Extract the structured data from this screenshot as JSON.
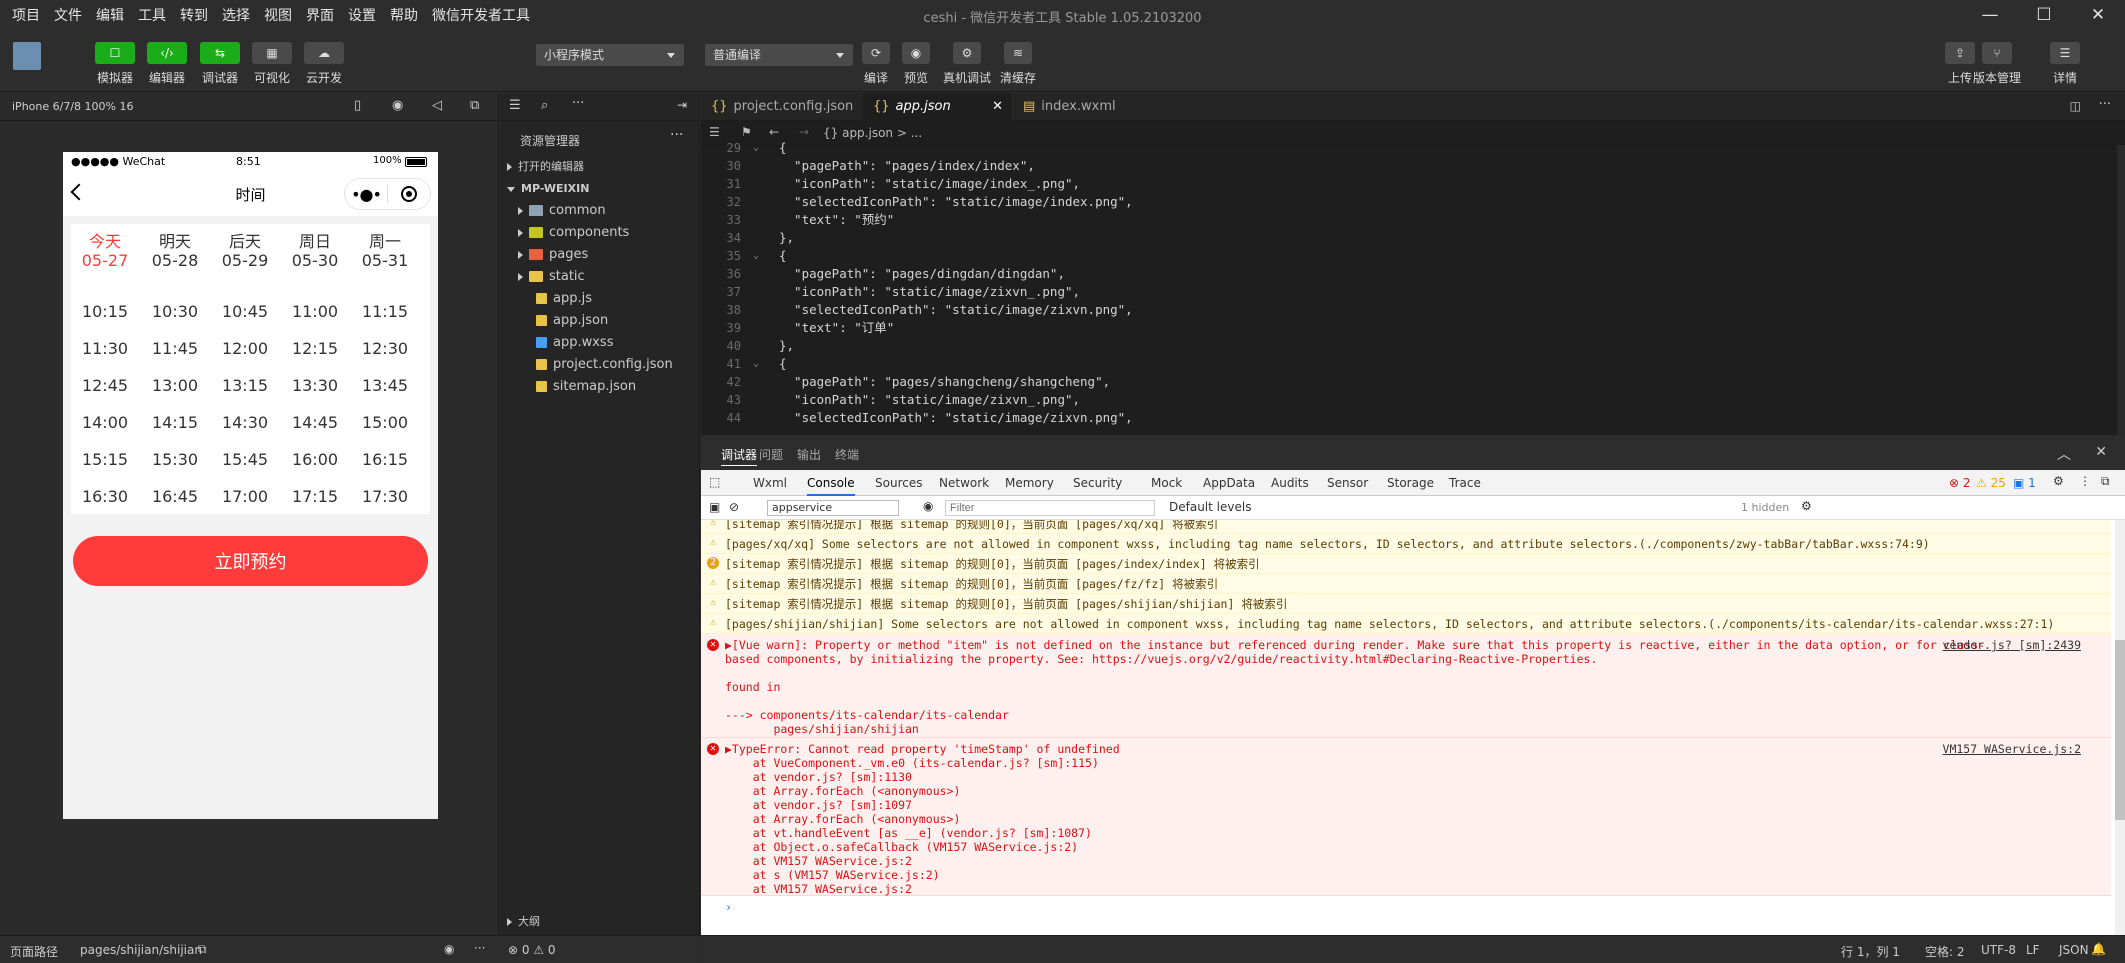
{
  "menubar": [
    "项目",
    "文件",
    "编辑",
    "工具",
    "转到",
    "选择",
    "视图",
    "界面",
    "设置",
    "帮助",
    "微信开发者工具"
  ],
  "window_title": "ceshi - 微信开发者工具 Stable 1.05.2103200",
  "toolbar": {
    "left_buttons": [
      {
        "label": "模拟器",
        "icon": "phone-icon"
      },
      {
        "label": "编辑器",
        "icon": "code-icon"
      },
      {
        "label": "调试器",
        "icon": "debug-icon"
      },
      {
        "label": "可视化",
        "icon": "grid-icon"
      },
      {
        "label": "云开发",
        "icon": "cloud-icon"
      }
    ],
    "mode_select": "小程序模式",
    "compile_select": "普通编译",
    "mid_buttons": [
      "编译",
      "预览",
      "真机调试",
      "清缓存"
    ],
    "right_buttons": [
      "上传",
      "版本管理",
      "详情"
    ]
  },
  "simulator": {
    "device": "iPhone 6/7/8 100% 16",
    "statusbar": {
      "carrier": "●●●●● WeChat",
      "time": "8:51",
      "battery": "100%"
    },
    "nav_title": "时间",
    "days": [
      {
        "name": "今天",
        "date": "05-27",
        "active": true
      },
      {
        "name": "明天",
        "date": "05-28"
      },
      {
        "name": "后天",
        "date": "05-29"
      },
      {
        "name": "周日",
        "date": "05-30"
      },
      {
        "name": "周一",
        "date": "05-31"
      }
    ],
    "slots": [
      [
        "10:15",
        "10:30",
        "10:45",
        "11:00",
        "11:15"
      ],
      [
        "11:30",
        "11:45",
        "12:00",
        "12:15",
        "12:30"
      ],
      [
        "12:45",
        "13:00",
        "13:15",
        "13:30",
        "13:45"
      ],
      [
        "14:00",
        "14:15",
        "14:30",
        "14:45",
        "15:00"
      ],
      [
        "15:15",
        "15:30",
        "15:45",
        "16:00",
        "16:15"
      ],
      [
        "16:30",
        "16:45",
        "17:00",
        "17:15",
        "17:30"
      ]
    ],
    "book_button": "立即预约"
  },
  "explorer": {
    "title": "资源管理器",
    "open_editors": "打开的编辑器",
    "root": "MP-WEIXIN",
    "items": [
      {
        "name": "common",
        "type": "folder",
        "color": "#8fa3b5"
      },
      {
        "name": "components",
        "type": "folder",
        "color": "#c6c623"
      },
      {
        "name": "pages",
        "type": "folder",
        "color": "#e8603c"
      },
      {
        "name": "static",
        "type": "folder",
        "color": "#e8c34a"
      },
      {
        "name": "app.js",
        "type": "js",
        "color": "#e8c34a"
      },
      {
        "name": "app.json",
        "type": "json",
        "color": "#e8c34a"
      },
      {
        "name": "app.wxss",
        "type": "css",
        "color": "#4a9cf0"
      },
      {
        "name": "project.config.json",
        "type": "json",
        "color": "#e8c34a"
      },
      {
        "name": "sitemap.json",
        "type": "json",
        "color": "#e8c34a"
      }
    ],
    "outline": "大纲"
  },
  "editor": {
    "tabs": [
      {
        "label": "project.config.json"
      },
      {
        "label": "app.json",
        "active": true
      },
      {
        "label": "index.wxml"
      }
    ],
    "breadcrumb": "{} app.json > ...",
    "lines": [
      {
        "n": "29",
        "t": "{"
      },
      {
        "n": "30",
        "t": "  \"pagePath\": \"pages/index/index\","
      },
      {
        "n": "31",
        "t": "  \"iconPath\": \"static/image/index_.png\","
      },
      {
        "n": "32",
        "t": "  \"selectedIconPath\": \"static/image/index.png\","
      },
      {
        "n": "33",
        "t": "  \"text\": \"预约\""
      },
      {
        "n": "34",
        "t": "},"
      },
      {
        "n": "35",
        "t": "{"
      },
      {
        "n": "36",
        "t": "  \"pagePath\": \"pages/dingdan/dingdan\","
      },
      {
        "n": "37",
        "t": "  \"iconPath\": \"static/image/zixvn_.png\","
      },
      {
        "n": "38",
        "t": "  \"selectedIconPath\": \"static/image/zixvn.png\","
      },
      {
        "n": "39",
        "t": "  \"text\": \"订单\""
      },
      {
        "n": "40",
        "t": "},"
      },
      {
        "n": "41",
        "t": "{"
      },
      {
        "n": "42",
        "t": "  \"pagePath\": \"pages/shangcheng/shangcheng\","
      },
      {
        "n": "43",
        "t": "  \"iconPath\": \"static/image/zixvn_.png\","
      },
      {
        "n": "44",
        "t": "  \"selectedIconPath\": \"static/image/zixvn.png\","
      }
    ]
  },
  "devtools": {
    "panel_tabs": [
      "调试器",
      "问题",
      "输出",
      "终端"
    ],
    "tool_tabs": [
      "Wxml",
      "Console",
      "Sources",
      "Network",
      "Memory",
      "Security",
      "Mock",
      "AppData",
      "Audits",
      "Sensor",
      "Storage",
      "Trace"
    ],
    "counts": {
      "errors": "2",
      "warnings": "25",
      "info": "1"
    },
    "context": "appservice",
    "filter_placeholder": "Filter",
    "levels": "Default levels",
    "hidden": "1 hidden",
    "messages": [
      {
        "level": "warn",
        "text": "[sitemap 索引情况提示] 根据 sitemap 的规则[0]，当前页面 [pages/xq/xq] 将被索引"
      },
      {
        "level": "warn",
        "text": "[pages/xq/xq] Some selectors are not allowed in component wxss, including tag name selectors, ID selectors, and attribute selectors.(./components/zwy-tabBar/tabBar.wxss:74:9)"
      },
      {
        "level": "warn",
        "badge": "2",
        "text": "[sitemap 索引情况提示] 根据 sitemap 的规则[0]，当前页面 [pages/index/index] 将被索引"
      },
      {
        "level": "warn",
        "text": "[sitemap 索引情况提示] 根据 sitemap 的规则[0]，当前页面 [pages/fz/fz] 将被索引"
      },
      {
        "level": "warn",
        "text": "[sitemap 索引情况提示] 根据 sitemap 的规则[0]，当前页面 [pages/shijian/shijian] 将被索引"
      },
      {
        "level": "warn",
        "text": "[pages/shijian/shijian] Some selectors are not allowed in component wxss, including tag name selectors, ID selectors, and attribute selectors.(./components/its-calendar/its-calendar.wxss:27:1)"
      }
    ],
    "vue_warn": {
      "text": "▶[Vue warn]: Property or method \"item\" is not defined on the instance but referenced during render. Make sure that this property is reactive, either in the data option, or for class-\nbased components, by initializing the property. See: https://vuejs.org/v2/guide/reactivity.html#Declaring-Reactive-Properties.\n\nfound in\n\n---> components/its-calendar/its-calendar\n       pages/shijian/shijian",
      "source": "vendor.js? [sm]:2439"
    },
    "type_error": {
      "text": "▶TypeError: Cannot read property 'timeStamp' of undefined\n    at VueComponent._vm.e0 (its-calendar.js? [sm]:115)\n    at vendor.js? [sm]:1130\n    at Array.forEach (<anonymous>)\n    at vendor.js? [sm]:1097\n    at Array.forEach (<anonymous>)\n    at vt.handleEvent [as __e] (vendor.js? [sm]:1087)\n    at Object.o.safeCallback (VM157 WAService.js:2)\n    at VM157 WAService.js:2\n    at s (VM157 WAService.js:2)\n    at VM157 WAService.js:2",
      "source": "VM157 WAService.js:2"
    },
    "prompt": "›"
  },
  "footer": {
    "page_path_label": "页面路径",
    "page_path": "pages/shijian/shijian",
    "problems": "⊗ 0 ⚠ 0",
    "cursor": "行 1，列 1",
    "spaces": "空格: 2",
    "encoding": "UTF-8",
    "eol": "LF",
    "lang": "JSON"
  }
}
